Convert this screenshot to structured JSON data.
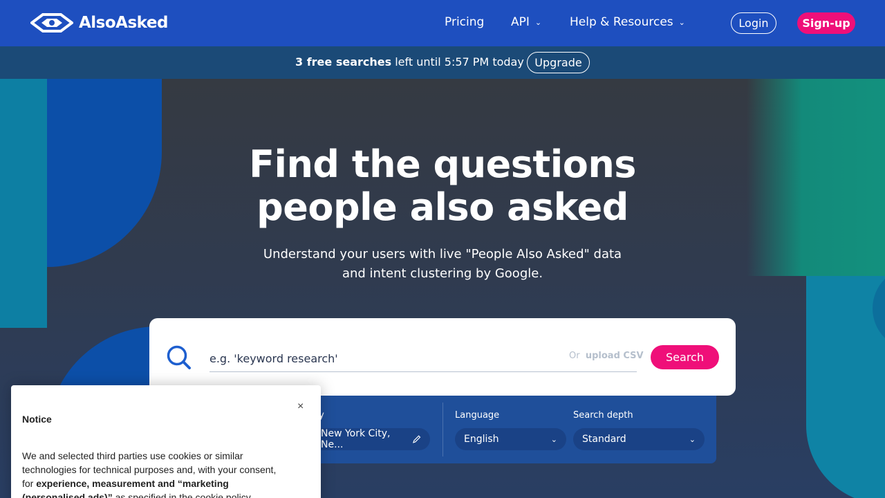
{
  "header": {
    "logo_text": "AlsoAsked",
    "nav": [
      {
        "label": "Pricing",
        "has_dropdown": false
      },
      {
        "label": "API",
        "has_dropdown": true
      },
      {
        "label": "Help & Resources",
        "has_dropdown": true
      }
    ],
    "login_label": "Login",
    "signup_label": "Sign-up"
  },
  "infobar": {
    "bold_text": "3 free searches",
    "rest_text": " left until 5:57 PM today",
    "upgrade_label": "Upgrade"
  },
  "hero": {
    "title_line1": "Find the questions",
    "title_line2": "people also asked",
    "subtitle_line1": "Understand your users with live \"People Also Asked\" data",
    "subtitle_line2": "and intent clustering by Google."
  },
  "search": {
    "placeholder": "e.g. 'keyword research'",
    "or_text": "Or",
    "upload_label": "upload CSV",
    "button_label": "Search"
  },
  "options": {
    "city_label": "ty",
    "city_value": "New York City, Ne...",
    "language_label": "Language",
    "language_value": "English",
    "depth_label": "Search depth",
    "depth_value": "Standard"
  },
  "notice": {
    "title": "Notice",
    "close_symbol": "×",
    "body_part1": "We and selected third parties use cookies or similar technologies for technical purposes and, with your consent, for ",
    "body_bold": "experience, measurement and “marketing (personalised ads)”",
    "body_part2": " as specified in the cookie policy."
  },
  "colors": {
    "brand_blue": "#1e4fbf",
    "info_bar": "#1b4a77",
    "accent_pink": "#ef0f79"
  }
}
